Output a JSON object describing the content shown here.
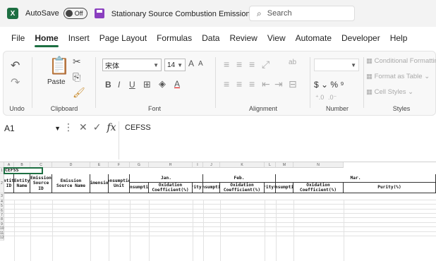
{
  "titlebar": {
    "app_logo": "X",
    "autosave_label": "AutoSave",
    "autosave_state": "Off",
    "doc_title": "Stationary Source Combustion Emissions",
    "doc_caret": "⌄",
    "search_placeholder": "Search"
  },
  "menu": {
    "tabs": [
      "File",
      "Home",
      "Insert",
      "Page Layout",
      "Formulas",
      "Data",
      "Review",
      "View",
      "Automate",
      "Developer",
      "Help"
    ],
    "active_tab": "Home"
  },
  "ribbon": {
    "undo_label": "Undo",
    "clipboard_label": "Clipboard",
    "paste_label": "Paste",
    "font_label": "Font",
    "font_name": "宋体",
    "font_size": "14",
    "alignment_label": "Alignment",
    "number_label": "Number",
    "number_symbols": "$ ⌄ % ⁹",
    "styles_label": "Styles",
    "conditional_formatting": "Conditional Formatting",
    "format_as_table": "Format as Table ⌄",
    "cell_styles": "Cell Styles ⌄"
  },
  "formula_bar": {
    "name_box": "A1",
    "content": "CEFSS"
  },
  "sheet": {
    "columns": [
      "A",
      "B",
      "C",
      "D",
      "E",
      "F",
      "G",
      "H",
      "I",
      "J",
      "K",
      "L",
      "M",
      "N"
    ],
    "rows": [
      "1",
      "2",
      "3",
      "4",
      "5",
      "6",
      "7",
      "8",
      "9",
      "10",
      "11",
      "12"
    ],
    "a1": "CEFSS",
    "headers": {
      "entity_id": "Entity ID",
      "entity_name": "Entity Name",
      "emission_source_id": "Emission Source ID",
      "emission_source_name": "Emission Source Name",
      "dimension": "Dimension",
      "consumption_unit": "Consumption Unit",
      "jan": "Jan.",
      "feb": "Feb.",
      "mar": "Mar.",
      "consumption": "consumption",
      "oxidation": "Oxidation Coefficient(%)",
      "purity": "Purity(%)"
    }
  }
}
